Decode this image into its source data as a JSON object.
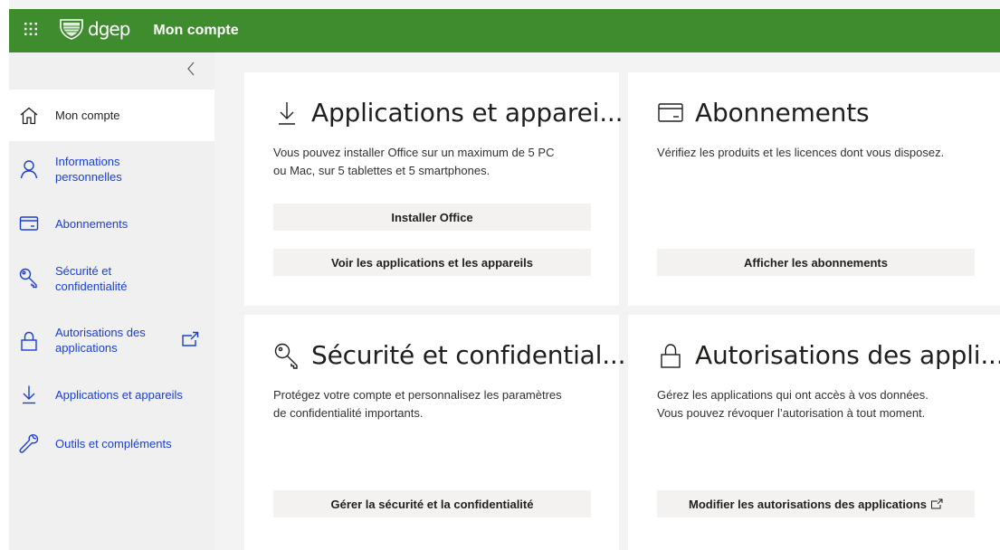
{
  "header": {
    "logo_text": "dgep",
    "app_title": "Mon compte"
  },
  "sidebar": {
    "items": [
      {
        "label": "Mon compte",
        "icon": "home-icon",
        "selected": true
      },
      {
        "label": "Informations personnelles",
        "icon": "person-icon",
        "selected": false
      },
      {
        "label": "Abonnements",
        "icon": "card-icon",
        "selected": false
      },
      {
        "label": "Sécurité et confidentialité",
        "icon": "key-icon",
        "selected": false
      },
      {
        "label": "Autorisations des applications",
        "icon": "lock-icon",
        "selected": false,
        "external": true
      },
      {
        "label": "Applications et appareils",
        "icon": "download-icon",
        "selected": false
      },
      {
        "label": "Outils et compléments",
        "icon": "wrench-icon",
        "selected": false
      }
    ]
  },
  "cards": {
    "apps": {
      "title": "Applications et apparei...",
      "desc_line1": "Vous pouvez installer Office sur un maximum de 5 PC",
      "desc_line2": "ou Mac, sur 5 tablettes et 5 smartphones.",
      "btn_install": "Installer Office",
      "btn_view": "Voir les applications et les appareils"
    },
    "subscriptions": {
      "title": "Abonnements",
      "desc_line1": "Vérifiez les produits et les licences dont vous disposez.",
      "btn_view": "Afficher les abonnements"
    },
    "security": {
      "title": "Sécurité et confidential...",
      "desc_line1": "Protégez votre compte et personnalisez les paramètres",
      "desc_line2": "de confidentialité importants.",
      "btn_manage": "Gérer la sécurité et la confidentialité"
    },
    "permissions": {
      "title": "Autorisations des appli...",
      "desc_line1": "Gérez les applications qui ont accès à vos données.",
      "desc_line2": "Vous pouvez révoquer l’autorisation à tout moment.",
      "btn_modify": "Modifier les autorisations des applications"
    }
  },
  "colors": {
    "header_bg": "#3f8c2f",
    "link": "#1a3fd6",
    "sidebar_bg": "#f0f0f0",
    "button_bg": "#f3f2f1"
  }
}
